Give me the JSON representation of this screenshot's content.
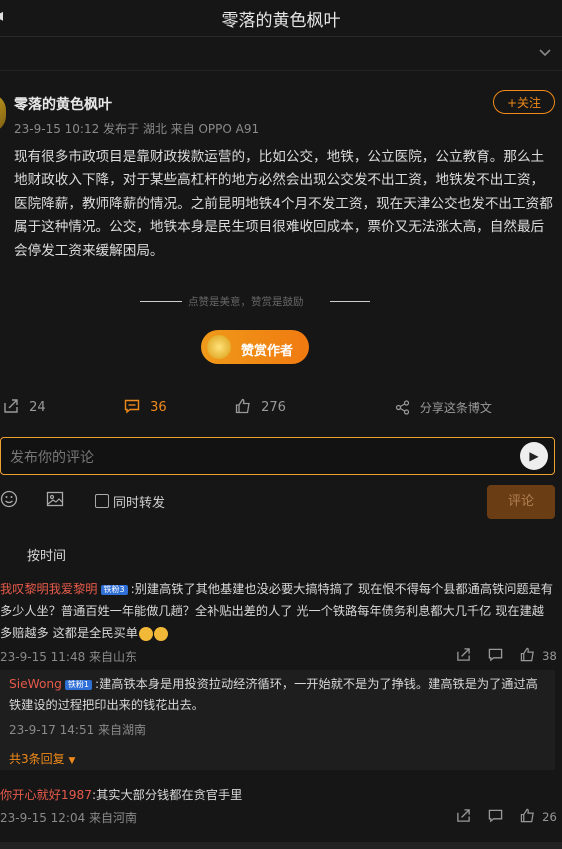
{
  "header": {
    "title": "零落的黄色枫叶"
  },
  "post": {
    "author": "零落的黄色枫叶",
    "meta": "23-9-15 10:12  发布于 湖北  来自 OPPO A91",
    "follow_label": "+关注",
    "body": "现有很多市政项目是靠财政拨款运营的，比如公交，地铁，公立医院，公立教育。那么土地财政收入下降，对于某些高杠杆的地方必然会出现公交发不出工资，地铁发不出工资，医院降薪，教师降薪的情况。之前昆明地铁4个月不发工资，现在天津公交也发不出工资都属于这种情况。公交，地铁本身是民生项目很难收回成本，票价又无法涨太高，自然最后会停发工资来缓解困局。",
    "reward_hint": "点赞是美意，赞赏是鼓励",
    "reward_button": "赞赏作者"
  },
  "actions": {
    "repost_count": "24",
    "comment_count": "36",
    "like_count": "276",
    "share_label": "分享这条博文"
  },
  "composer": {
    "placeholder": "发布你的评论",
    "repost_label": "同时转发",
    "submit_label": "评论"
  },
  "sort_label": "按时间",
  "comments": [
    {
      "user": "我叹黎明我爱黎明",
      "badge": "铁粉3",
      "text": ":别建高铁了其他基建也没必要大搞特搞了 现在恨不得每个县都通高铁问题是有多少人坐？普通百姓一年能做几趟？全补贴出差的人了 光一个铁路每年债务利息都大几千亿 现在建越多赔越多 这都是全民买单",
      "meta": "23-9-15 11:48 来自山东",
      "likes": "38",
      "reply": {
        "user": "SieWong",
        "badge": "铁粉1",
        "text": ":建高铁本身是用投资拉动经济循环，一开始就不是为了挣钱。建高铁是为了通过高铁建设的过程把印出来的钱花出去。",
        "meta": "23-9-17 14:51 来自湖南"
      },
      "more_replies": "共3条回复"
    },
    {
      "user": "你开心就好1987",
      "text": ":其实大部分钱都在贪官手里",
      "meta": "23-9-15 12:04 来自河南",
      "likes": "26"
    }
  ],
  "colors": {
    "accent": "#f08a1a",
    "username": "#e65a4a",
    "background": "#161616"
  }
}
